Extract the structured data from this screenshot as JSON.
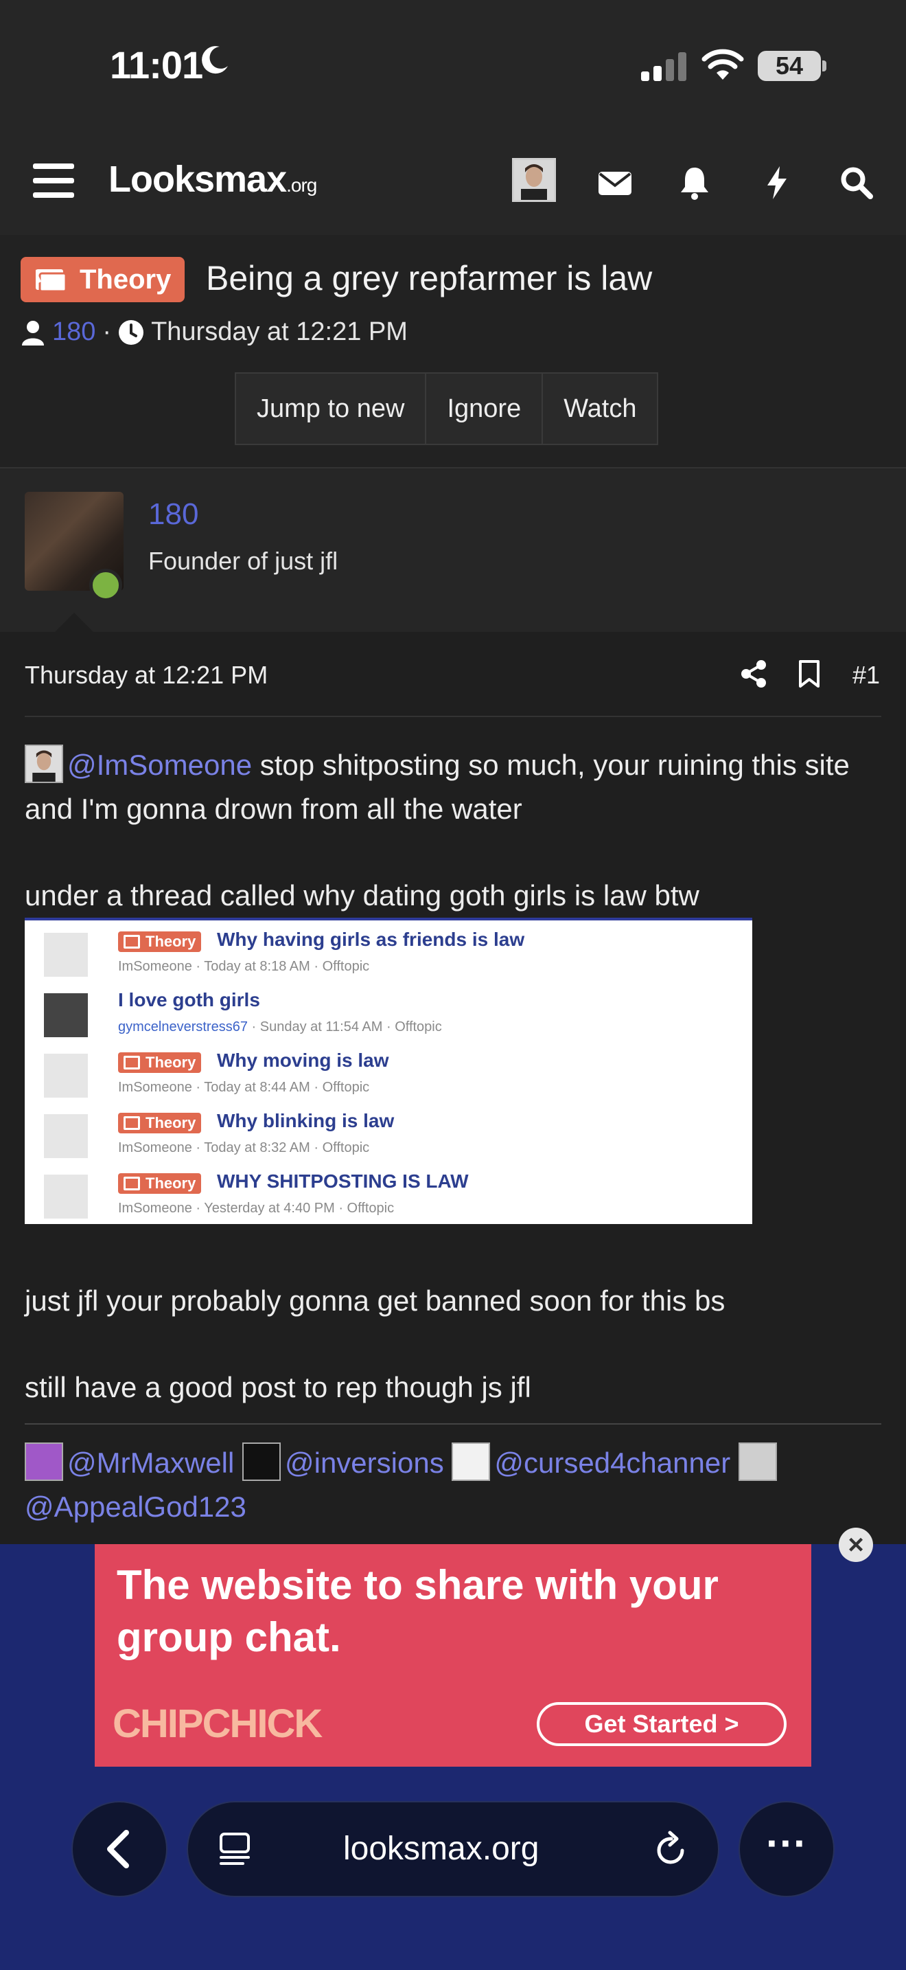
{
  "status_bar": {
    "time": "11:01",
    "battery": "54"
  },
  "header": {
    "logo": "Looksmax",
    "logo_suffix": ".org",
    "icons": [
      "menu-icon",
      "avatar",
      "envelope-icon",
      "bell-icon",
      "bolt-icon",
      "search-icon"
    ]
  },
  "thread": {
    "prefix": "Theory",
    "title": "Being a grey repfarmer is law",
    "author": "180",
    "date": "Thursday at 12:21 PM",
    "actions": [
      "Jump to new",
      "Ignore",
      "Watch"
    ]
  },
  "user": {
    "name": "180",
    "user_title": "Founder of just jfl"
  },
  "post": {
    "date": "Thursday at 12:21 PM",
    "number": "#1",
    "mention1": "@ImSomeone",
    "line1_rest": " stop shitposting so much, your ruining this site and I'm gonna drown from all the water",
    "line2": "under a thread called why dating goth girls is law btw",
    "line3": "just jfl your probably gonna get banned soon for this bs",
    "line4": "still have a good post to rep though js jfl",
    "signature_mentions": [
      "@MrMaxwell",
      "@inversions",
      "@cursed4channer",
      "@AppealGod123"
    ]
  },
  "embed": {
    "rows": [
      {
        "prefix": "Theory",
        "title": "Why having girls as friends is law",
        "user": "ImSomeone",
        "date": "Today at 8:18 AM",
        "forum": "Offtopic"
      },
      {
        "prefix": "",
        "title": "I love goth girls",
        "user": "gymcelneverstress67",
        "date": "Sunday at 11:54 AM",
        "forum": "Offtopic"
      },
      {
        "prefix": "Theory",
        "title": "Why moving is law",
        "user": "ImSomeone",
        "date": "Today at 8:44 AM",
        "forum": "Offtopic"
      },
      {
        "prefix": "Theory",
        "title": "Why blinking is law",
        "user": "ImSomeone",
        "date": "Today at 8:32 AM",
        "forum": "Offtopic"
      },
      {
        "prefix": "Theory",
        "title": "WHY SHITPOSTING IS LAW",
        "user": "ImSomeone",
        "date": "Yesterday at 4:40 PM",
        "forum": "Offtopic"
      }
    ]
  },
  "ad": {
    "headline": "The website to share with your group chat.",
    "brand": "CHIPCHICK",
    "cta": "Get Started >"
  },
  "browser": {
    "url": "looksmax.org"
  },
  "colors": {
    "accent": "#5a68d8",
    "prefix": "#e0694f",
    "ad_bg": "#e0465c",
    "ad_bar": "#1c2870"
  }
}
